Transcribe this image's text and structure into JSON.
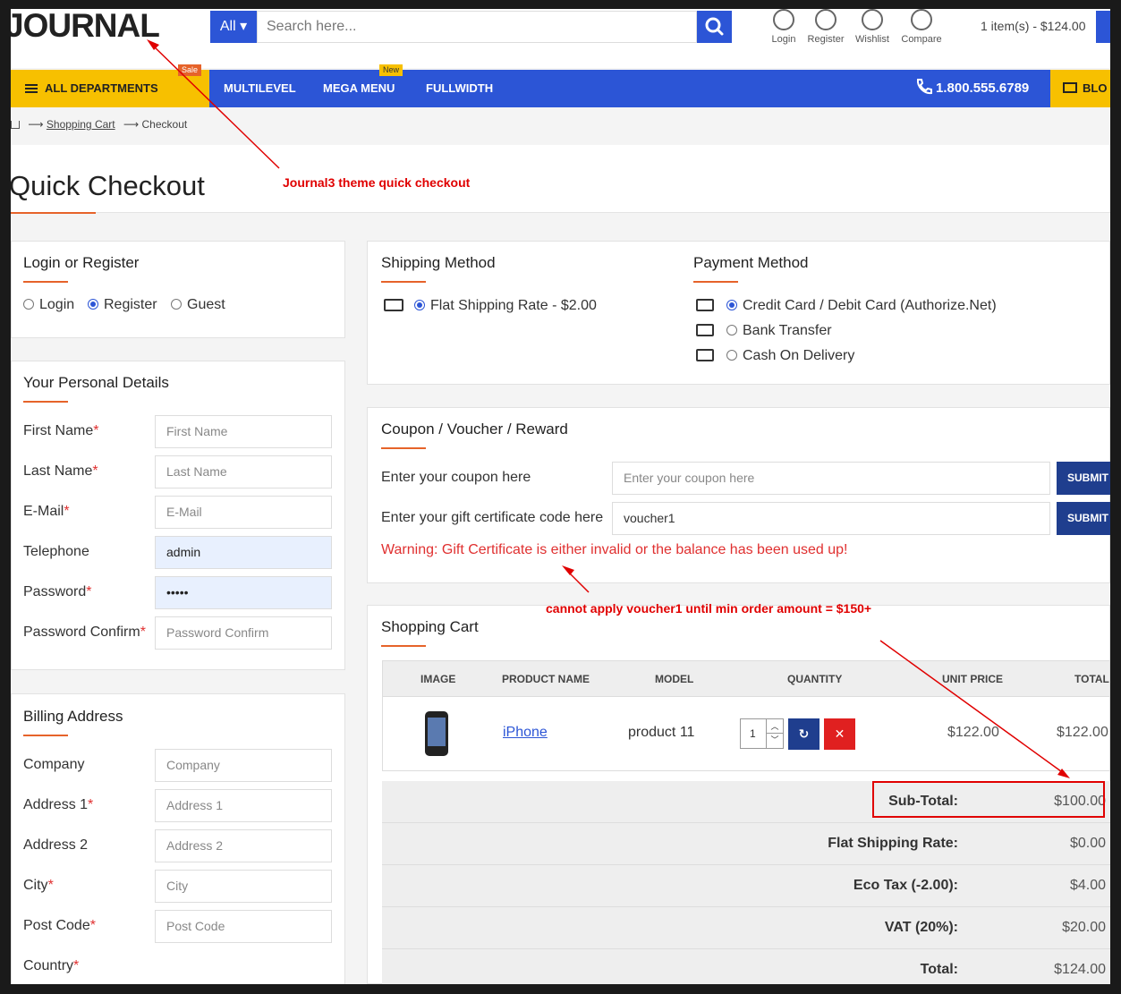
{
  "header": {
    "logo": "JOURNAL",
    "search_category": "All ▾",
    "search_placeholder": "Search here...",
    "icons": [
      {
        "label": "Login",
        "icon": "user-icon"
      },
      {
        "label": "Register",
        "icon": "pencil-icon"
      },
      {
        "label": "Wishlist",
        "icon": "heart-icon"
      },
      {
        "label": "Compare",
        "icon": "compare-arrows-icon"
      }
    ],
    "cart_summary": "1 item(s) - $124.00"
  },
  "nav": {
    "all_departments": "ALL DEPARTMENTS",
    "sale_badge": "Sale",
    "multilevel": "MULTILEVEL",
    "mega_menu": "MEGA MENU",
    "new_badge": "New",
    "fullwidth": "FULLWIDTH",
    "phone": "1.800.555.6789",
    "blog": "BLO"
  },
  "breadcrumb": {
    "home_icon": "home-icon",
    "arrow": "⟶",
    "shopping_cart": "Shopping Cart",
    "checkout": "Checkout"
  },
  "page_title": "Quick Checkout",
  "annotations": {
    "top": "Journal3 theme quick checkout",
    "voucher": "cannot apply voucher1 until min order amount = $150+"
  },
  "login": {
    "title": "Login or Register",
    "options": [
      {
        "label": "Login",
        "selected": false
      },
      {
        "label": "Register",
        "selected": true
      },
      {
        "label": "Guest",
        "selected": false
      }
    ]
  },
  "personal": {
    "title": "Your Personal Details",
    "fields": [
      {
        "label": "First Name",
        "required": "*",
        "placeholder": "First Name",
        "value": ""
      },
      {
        "label": "Last Name",
        "required": "*",
        "placeholder": "Last Name",
        "value": ""
      },
      {
        "label": "E-Mail",
        "required": "*",
        "placeholder": "E-Mail",
        "value": ""
      },
      {
        "label": "Telephone",
        "required": "",
        "placeholder": "",
        "value": "admin"
      },
      {
        "label": "Password",
        "required": "*",
        "placeholder": "",
        "value": "•••••"
      },
      {
        "label": "Password Confirm",
        "required": "*",
        "placeholder": "Password Confirm",
        "value": ""
      }
    ]
  },
  "billing": {
    "title": "Billing Address",
    "fields": [
      {
        "label": "Company",
        "required": "",
        "placeholder": "Company"
      },
      {
        "label": "Address 1",
        "required": "*",
        "placeholder": "Address 1"
      },
      {
        "label": "Address 2",
        "required": "",
        "placeholder": "Address 2"
      },
      {
        "label": "City",
        "required": "*",
        "placeholder": "City"
      },
      {
        "label": "Post Code",
        "required": "*",
        "placeholder": "Post Code"
      },
      {
        "label": "Country",
        "required": "*",
        "placeholder": ""
      }
    ]
  },
  "shipping": {
    "title": "Shipping Method",
    "option": "Flat Shipping Rate - $2.00"
  },
  "payment": {
    "title": "Payment Method",
    "options": [
      {
        "label": "Credit Card / Debit Card (Authorize.Net)",
        "selected": true,
        "icon": "card-icon"
      },
      {
        "label": "Bank Transfer",
        "selected": false,
        "icon": "bank-transfer-icon"
      },
      {
        "label": "Cash On Delivery",
        "selected": false,
        "icon": "cash-icon"
      }
    ]
  },
  "coupon": {
    "title": "Coupon / Voucher / Reward",
    "coupon_label": "Enter your coupon here",
    "coupon_placeholder": "Enter your coupon here",
    "gift_label": "Enter your gift certificate code here",
    "gift_value": "voucher1",
    "submit": "SUBMIT",
    "warning": "Warning: Gift Certificate is either invalid or the balance has been used up!"
  },
  "cart": {
    "title": "Shopping Cart",
    "columns": [
      "IMAGE",
      "PRODUCT NAME",
      "MODEL",
      "QUANTITY",
      "UNIT PRICE",
      "TOTAL"
    ],
    "rows": [
      {
        "product": "iPhone",
        "model": "product 11",
        "quantity": "1",
        "unit_price": "$122.00",
        "total": "$122.00"
      }
    ],
    "totals": [
      {
        "label": "Sub-Total:",
        "value": "$100.00"
      },
      {
        "label": "Flat Shipping Rate:",
        "value": "$0.00"
      },
      {
        "label": "Eco Tax (-2.00):",
        "value": "$4.00"
      },
      {
        "label": "VAT (20%):",
        "value": "$20.00"
      },
      {
        "label": "Total:",
        "value": "$124.00"
      }
    ]
  },
  "colors": {
    "primary": "#2c55d6",
    "accent": "#f7c000",
    "underline": "#e6632a",
    "danger": "#e03030",
    "submit": "#1f3e8e"
  }
}
